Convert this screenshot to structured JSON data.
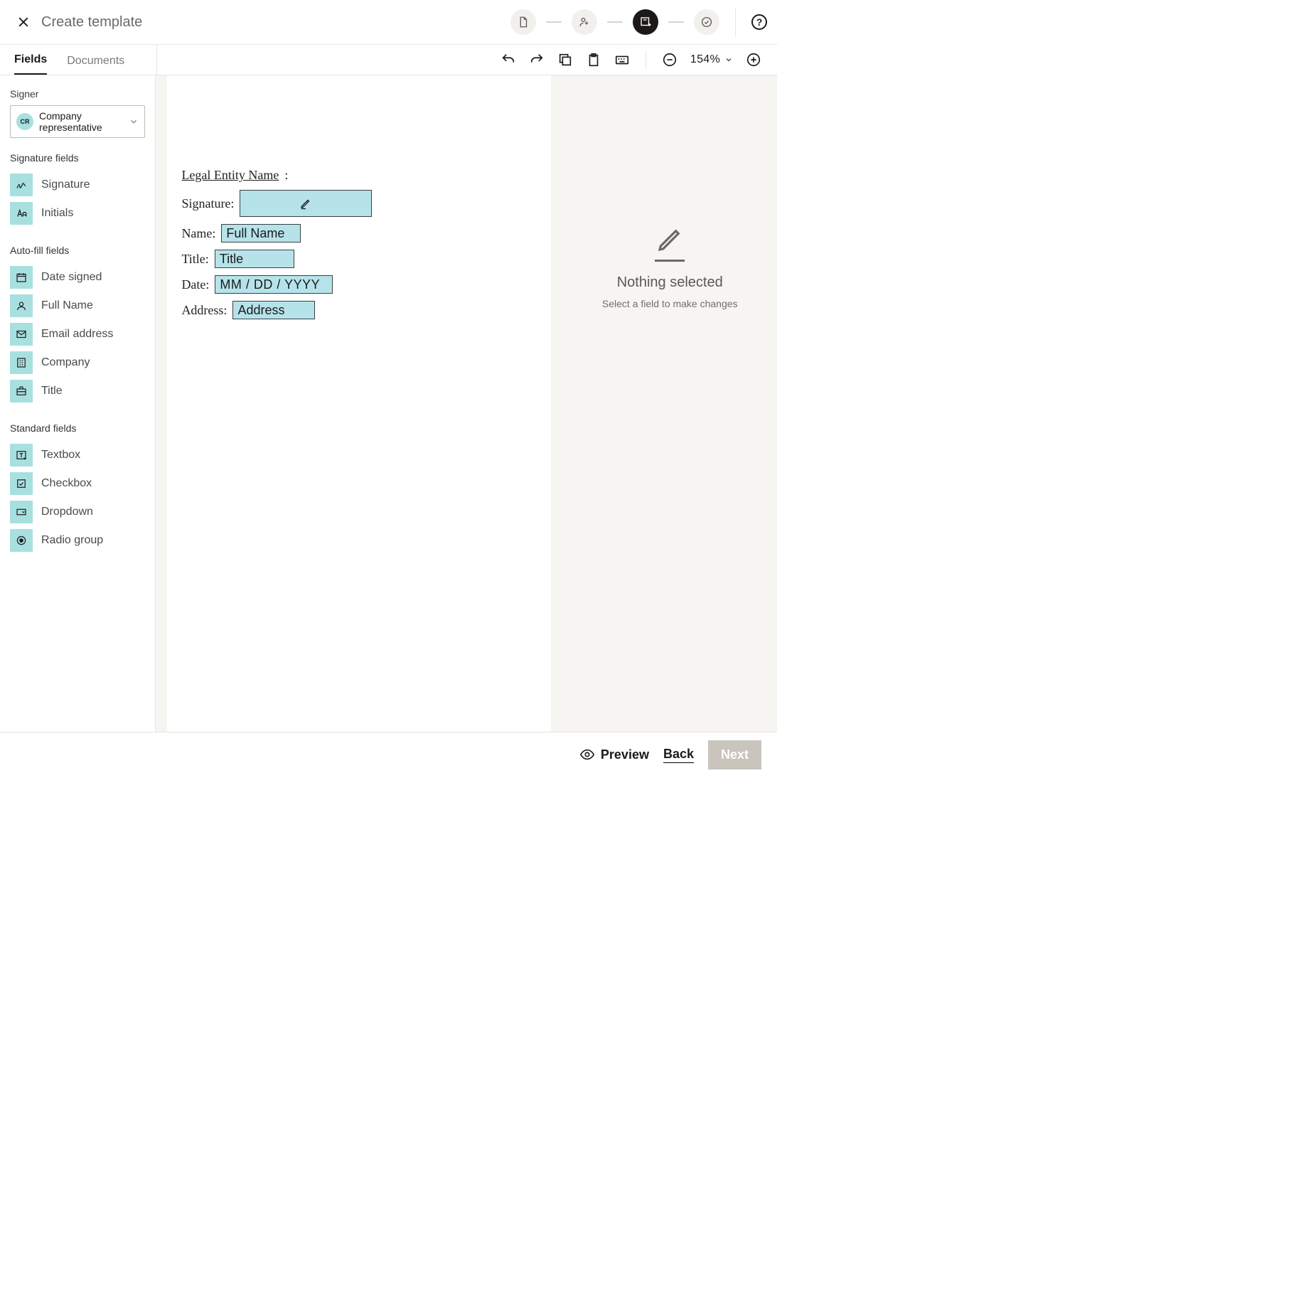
{
  "header": {
    "title": "Create template"
  },
  "tabs": {
    "fields": "Fields",
    "documents": "Documents"
  },
  "toolbar": {
    "zoom": "154%"
  },
  "sidebar": {
    "signer_label": "Signer",
    "signer_avatar": "CR",
    "signer_name": "Company representative",
    "group_signature": "Signature fields",
    "sig_items": [
      {
        "label": "Signature"
      },
      {
        "label": "Initials"
      }
    ],
    "group_autofill": "Auto-fill fields",
    "auto_items": [
      {
        "label": "Date signed"
      },
      {
        "label": "Full Name"
      },
      {
        "label": "Email address"
      },
      {
        "label": "Company"
      },
      {
        "label": "Title"
      }
    ],
    "group_standard": "Standard fields",
    "std_items": [
      {
        "label": "Textbox"
      },
      {
        "label": "Checkbox"
      },
      {
        "label": "Dropdown"
      },
      {
        "label": "Radio group"
      }
    ]
  },
  "document": {
    "legal_entity_label": "Legal Entity Name",
    "signature_label": "Signature:",
    "name_label": "Name:",
    "name_field": "Full Name",
    "title_label": "Title:",
    "title_field": "Title",
    "date_label": "Date:",
    "date_field": "MM / DD / YYYY",
    "address_label": "Address:",
    "address_field": "Address"
  },
  "right_panel": {
    "title": "Nothing selected",
    "subtitle": "Select a field to make changes"
  },
  "footer": {
    "preview": "Preview",
    "back": "Back",
    "next": "Next"
  }
}
